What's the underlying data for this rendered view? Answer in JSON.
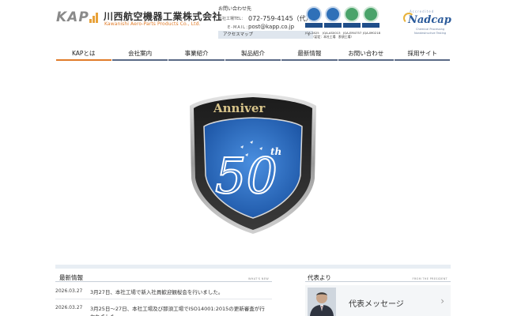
{
  "header": {
    "logo": {
      "mark": "KAP",
      "name_jp": "川西航空機器工業株式会社",
      "name_en": "Kawanishi Aero-Parts Products Co., Ltd."
    },
    "contact": {
      "title": "お問い合わせ先",
      "tel_label": "本社工場TEL：",
      "tel": "072-759-4145（代）",
      "mail_label": "E-MAIL：",
      "mail": "post@kapp.co.jp"
    },
    "access_label": "アクセスマップ",
    "certs": {
      "captions": [
        "JQA-2825",
        "JQA-AS0013",
        "JQA-EM4757",
        "JQA-IM0218"
      ],
      "note": "（認定：本社工場　那須工場）"
    },
    "nadcap": {
      "arc_text": "Accredited",
      "word": "Nadcap",
      "sub1": "Chemical Processing",
      "sub2": "Nondestructive Testing"
    }
  },
  "nav": {
    "items": [
      "KAPとは",
      "会社案内",
      "事業紹介",
      "製品紹介",
      "最新情報",
      "お問い合わせ",
      "採用サイト"
    ]
  },
  "hero": {
    "badge_text": "Anniver",
    "badge_number": "50",
    "badge_suffix": "th"
  },
  "news": {
    "title": "最新情報",
    "title_en": "WHAT'S NEW",
    "items": [
      {
        "date": "2026.03.27",
        "text": "3月27日、本社工場で新入社員歓迎観桜会を行いました。"
      },
      {
        "date": "2026.03.27",
        "text": "3月25日〜27日、本社工場及び那須工場でISO14001:2015の更新審査が行われました。"
      }
    ]
  },
  "representative": {
    "title": "代表より",
    "title_en": "FROM THE PRESIDENT",
    "message": "代表メッセージ"
  },
  "colors": {
    "accent": "#e07c2a",
    "nav_underline": "#5a6a86",
    "badge_blue": "#2f6fc0"
  }
}
